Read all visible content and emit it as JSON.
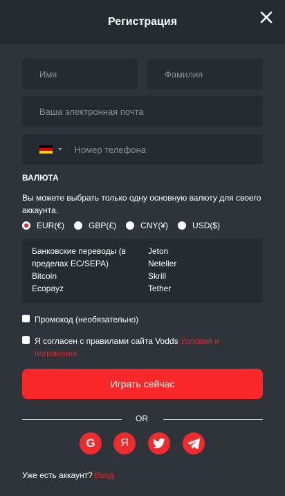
{
  "header": {
    "title": "Регистрация"
  },
  "form": {
    "first_name_placeholder": "Имя",
    "last_name_placeholder": "Фамилия",
    "email_placeholder": "Ваша электронная почта",
    "phone_placeholder": "Номер телефона"
  },
  "currency": {
    "label": "ВАЛЮТА",
    "note": "Вы можете выбрать только одну основную валюту для своего аккаунта.",
    "options": [
      "EUR(€)",
      "GBP(£)",
      "CNY(¥)",
      "USD($)"
    ],
    "selected": "EUR(€)"
  },
  "payment_methods": {
    "col1": [
      "Банковские переводы (в пределах ЕС/SEPA)",
      "Bitcoin",
      "Ecopayz"
    ],
    "col2": [
      "Jeton",
      "Neteller",
      "Skrill",
      "Tether"
    ]
  },
  "promo": {
    "label": "Промокод (необязательно)"
  },
  "terms": {
    "text": "Я согласен с правилами сайта Vodds ",
    "link": "Условия и положения"
  },
  "play_button": "Играть сейчас",
  "or_text": "OR",
  "social": {
    "google_glyph": "G",
    "yandex_glyph": "Я"
  },
  "login": {
    "text": "Уже есть аккаунт? ",
    "link": "Вход"
  },
  "colors": {
    "accent": "#f7272a",
    "background": "#2f343b",
    "field": "#262b31"
  }
}
